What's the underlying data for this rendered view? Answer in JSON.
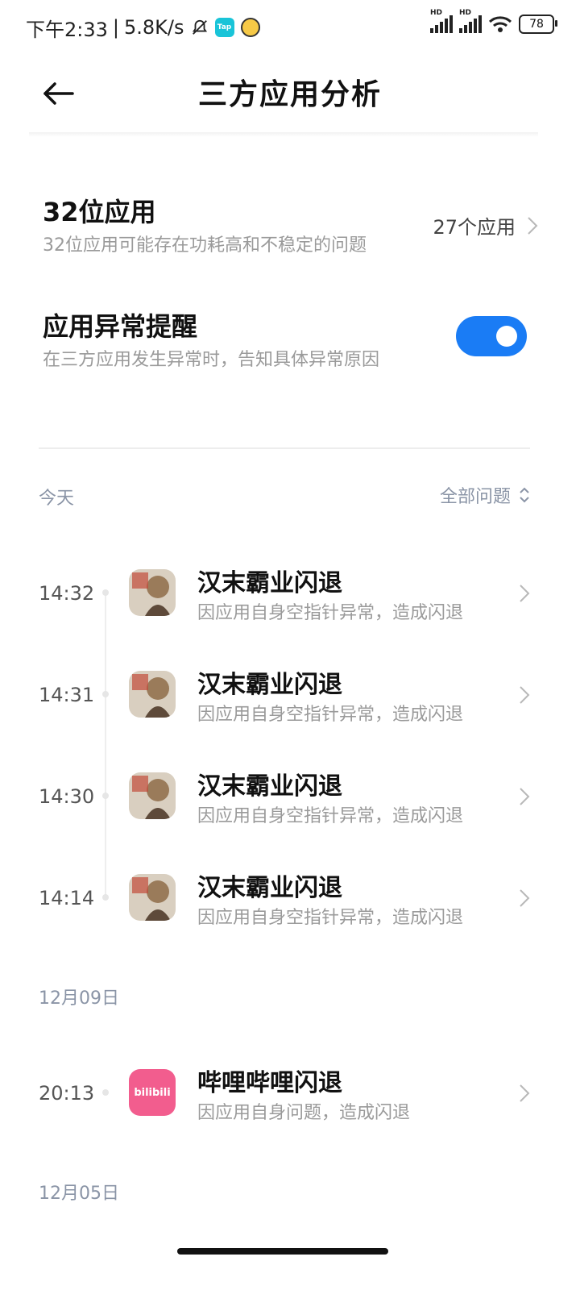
{
  "status_bar": {
    "time": "下午2:33",
    "speed": "5.8K/s",
    "tap_label": "Tap",
    "sim1_label": "HD",
    "sim2_label": "HD",
    "battery": "78"
  },
  "header": {
    "title": "三方应用分析"
  },
  "settings": {
    "app32": {
      "title": "32位应用",
      "subtitle": "32位应用可能存在功耗高和不稳定的问题",
      "value": "27个应用"
    },
    "crash_alert": {
      "title": "应用异常提醒",
      "subtitle": "在三方应用发生异常时，告知具体异常原因",
      "enabled": true
    }
  },
  "filter": {
    "label": "全部问题"
  },
  "sections": [
    {
      "label": "今天",
      "events": [
        {
          "time": "14:32",
          "title": "汉末霸业闪退",
          "subtitle": "因应用自身空指针异常，造成闪退",
          "icon": "game-hanmo-icon"
        },
        {
          "time": "14:31",
          "title": "汉末霸业闪退",
          "subtitle": "因应用自身空指针异常，造成闪退",
          "icon": "game-hanmo-icon"
        },
        {
          "time": "14:30",
          "title": "汉末霸业闪退",
          "subtitle": "因应用自身空指针异常，造成闪退",
          "icon": "game-hanmo-icon"
        },
        {
          "time": "14:14",
          "title": "汉末霸业闪退",
          "subtitle": "因应用自身空指针异常，造成闪退",
          "icon": "game-hanmo-icon"
        }
      ]
    },
    {
      "label": "12月09日",
      "events": [
        {
          "time": "20:13",
          "title": "哔哩哔哩闪退",
          "subtitle": "因应用自身问题，造成闪退",
          "icon": "bilibili-icon",
          "icon_text": "bilibili"
        }
      ]
    },
    {
      "label": "12月05日",
      "events": []
    }
  ],
  "colors": {
    "accent": "#1a7cf5",
    "bilibili": "#f25d8e",
    "muted": "#9a9a9a",
    "section": "#8a94a6"
  }
}
